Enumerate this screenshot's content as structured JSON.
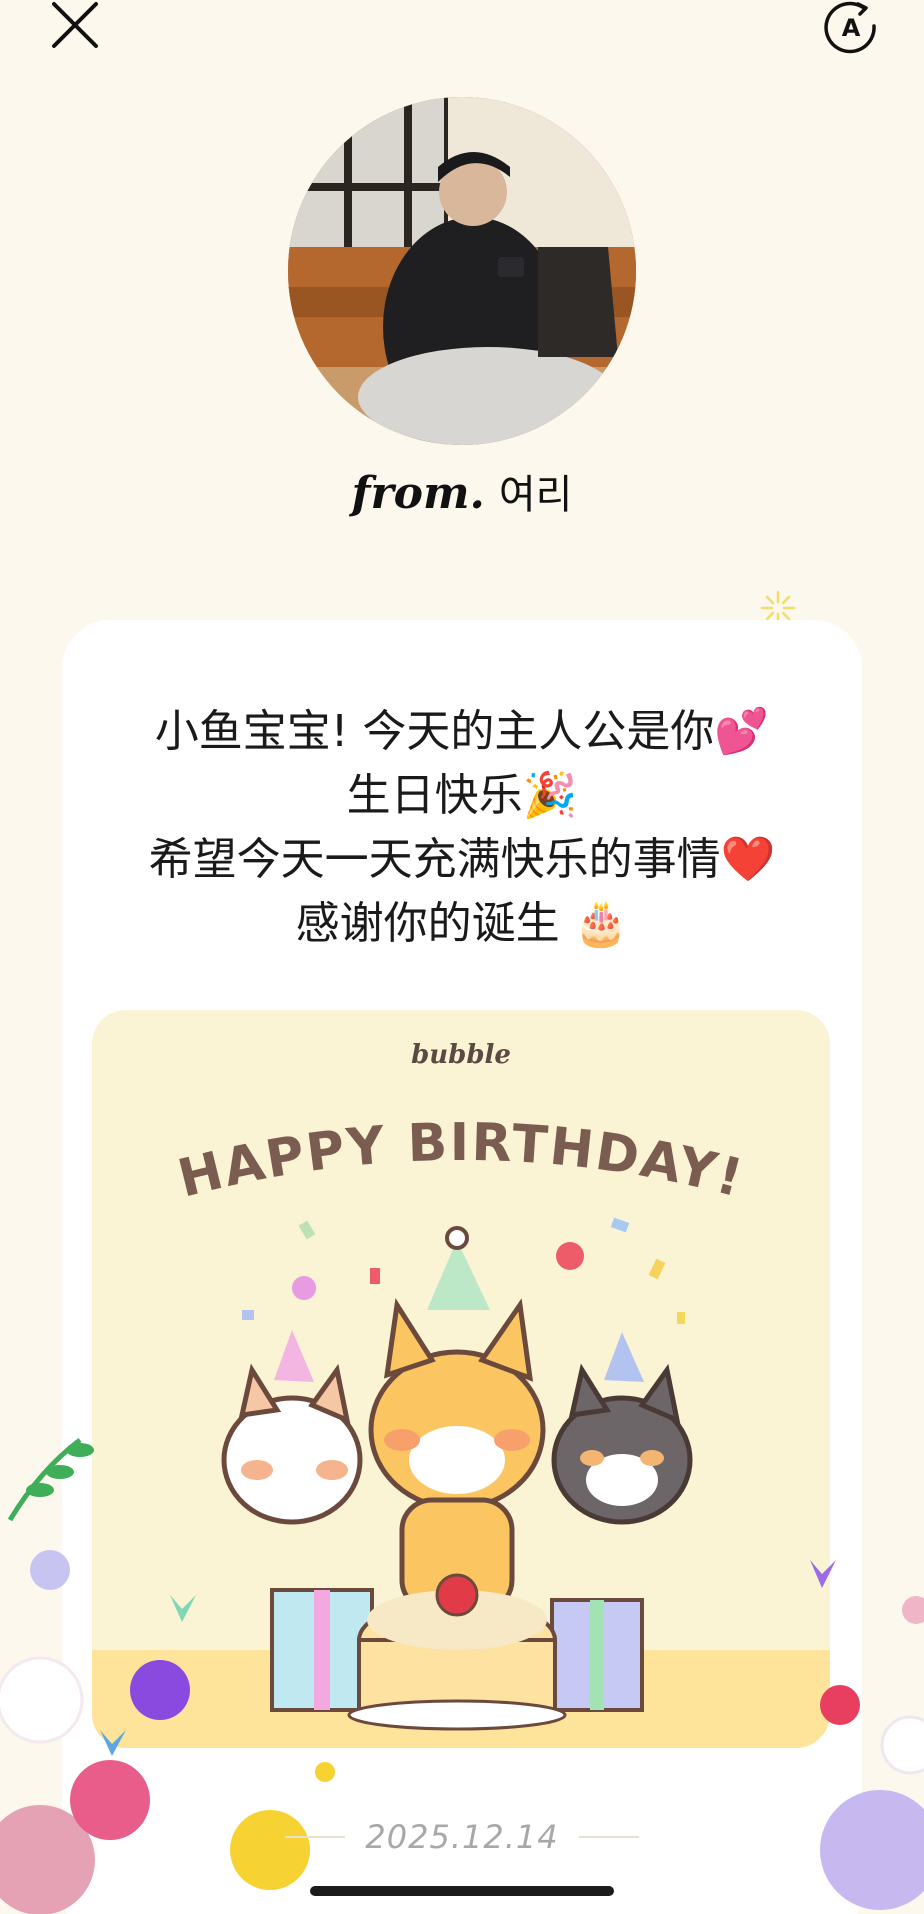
{
  "header": {
    "close_icon": "close-icon",
    "translate_icon": "translate-icon"
  },
  "sender": {
    "from_label": "from.",
    "name": "여리"
  },
  "message": {
    "lines": [
      "小鱼宝宝! 今天的主人公是你💕",
      "生日快乐🎉",
      "希望今天一天充满快乐的事情❤️",
      "感谢你的诞生 🎂"
    ]
  },
  "card_image": {
    "logo": "bubble",
    "title": "HAPPY BIRTHDAY!"
  },
  "footer": {
    "date": "2025.12.14"
  },
  "colors": {
    "background": "#fdf8ed",
    "card": "#ffffff",
    "bday_bg": "#faf3d4",
    "title_brown": "#7a5c50"
  }
}
